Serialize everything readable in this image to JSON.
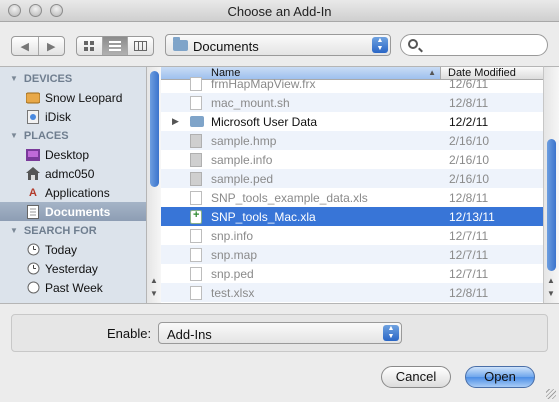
{
  "window": {
    "title": "Choose an Add-In"
  },
  "toolbar": {
    "back_glyph": "◀",
    "forward_glyph": "▶",
    "location": "Documents",
    "search_placeholder": "",
    "view_modes": [
      "icon-view",
      "list-view",
      "column-view"
    ],
    "active_view": "list-view"
  },
  "sidebar": {
    "sections": [
      {
        "title": "DEVICES",
        "items": [
          {
            "label": "Snow Leopard",
            "icon": "hard-drive-icon"
          },
          {
            "label": "iDisk",
            "icon": "idisk-icon"
          }
        ]
      },
      {
        "title": "PLACES",
        "items": [
          {
            "label": "Desktop",
            "icon": "desktop-icon"
          },
          {
            "label": "admc050",
            "icon": "home-icon"
          },
          {
            "label": "Applications",
            "icon": "applications-icon"
          },
          {
            "label": "Documents",
            "icon": "documents-icon",
            "selected": true
          }
        ]
      },
      {
        "title": "SEARCH FOR",
        "items": [
          {
            "label": "Today",
            "icon": "clock-icon"
          },
          {
            "label": "Yesterday",
            "icon": "clock-icon"
          },
          {
            "label": "Past Week",
            "icon": "clock-icon"
          }
        ]
      }
    ]
  },
  "filelist": {
    "columns": {
      "name": "Name",
      "date": "Date Modified"
    },
    "rows": [
      {
        "name": "frmHapMapView.frx",
        "date": "12/6/11",
        "dim": true,
        "type": "doc"
      },
      {
        "name": "mac_mount.sh",
        "date": "12/8/11",
        "dim": true,
        "type": "doc"
      },
      {
        "name": "Microsoft User Data",
        "date": "12/2/11",
        "dim": false,
        "type": "folder"
      },
      {
        "name": "sample.hmp",
        "date": "2/16/10",
        "dim": true,
        "type": "grey"
      },
      {
        "name": "sample.info",
        "date": "2/16/10",
        "dim": true,
        "type": "grey"
      },
      {
        "name": "sample.ped",
        "date": "2/16/10",
        "dim": true,
        "type": "grey"
      },
      {
        "name": "SNP_tools_example_data.xls",
        "date": "12/8/11",
        "dim": true,
        "type": "doc"
      },
      {
        "name": "SNP_tools_Mac.xla",
        "date": "12/13/11",
        "dim": false,
        "type": "xla",
        "selected": true
      },
      {
        "name": "snp.info",
        "date": "12/7/11",
        "dim": true,
        "type": "doc"
      },
      {
        "name": "snp.map",
        "date": "12/7/11",
        "dim": true,
        "type": "doc"
      },
      {
        "name": "snp.ped",
        "date": "12/7/11",
        "dim": true,
        "type": "doc"
      },
      {
        "name": "test.xlsx",
        "date": "12/8/11",
        "dim": true,
        "type": "doc"
      }
    ]
  },
  "footer": {
    "enable_label": "Enable:",
    "enable_value": "Add-Ins",
    "cancel_label": "Cancel",
    "open_label": "Open"
  },
  "colors": {
    "selection": "#3875d7",
    "sidebar_bg": "#dce3eb",
    "accent": "#4c8ee6"
  }
}
